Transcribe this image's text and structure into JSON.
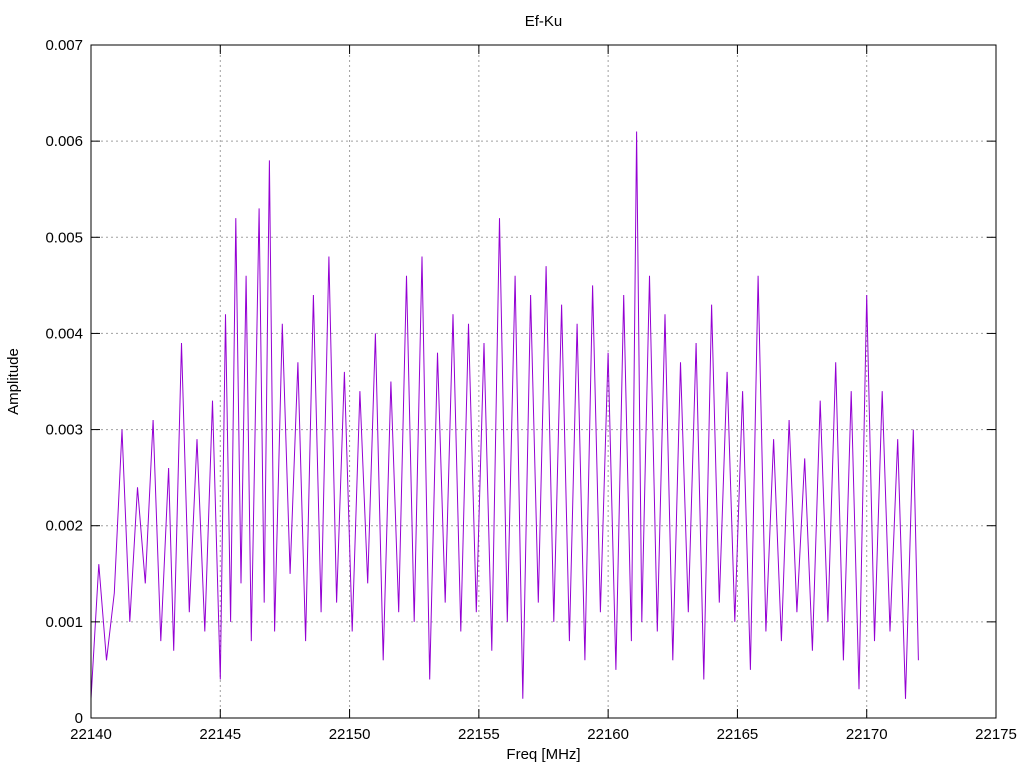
{
  "chart_data": {
    "type": "line",
    "title": "Ef-Ku",
    "xlabel": "Freq [MHz]",
    "ylabel": "Amplitude",
    "xlim": [
      22140,
      22175
    ],
    "ylim": [
      0,
      0.007
    ],
    "x_ticks": [
      22140,
      22145,
      22150,
      22155,
      22160,
      22165,
      22170,
      22175
    ],
    "y_ticks": [
      0,
      0.001,
      0.002,
      0.003,
      0.004,
      0.005,
      0.006,
      0.007
    ],
    "x_tick_labels": [
      "22140",
      "22145",
      "22150",
      "22155",
      "22160",
      "22165",
      "22170",
      "22175"
    ],
    "y_tick_labels": [
      "0",
      "0.001",
      "0.002",
      "0.003",
      "0.004",
      "0.005",
      "0.006",
      "0.007"
    ],
    "grid": true,
    "line_color": "#9400d3",
    "series": [
      {
        "x": [
          22140.0,
          22140.3,
          22140.6,
          22140.9,
          22141.2,
          22141.5,
          22141.8,
          22142.1,
          22142.4,
          22142.7,
          22143.0,
          22143.2,
          22143.5,
          22143.8,
          22144.1,
          22144.4,
          22144.7,
          22145.0,
          22145.2,
          22145.4,
          22145.6,
          22145.8,
          22146.0,
          22146.2,
          22146.5,
          22146.7,
          22146.9,
          22147.1,
          22147.4,
          22147.7,
          22148.0,
          22148.3,
          22148.6,
          22148.9,
          22149.2,
          22149.5,
          22149.8,
          22150.1,
          22150.4,
          22150.7,
          22151.0,
          22151.3,
          22151.6,
          22151.9,
          22152.2,
          22152.5,
          22152.8,
          22153.1,
          22153.4,
          22153.7,
          22154.0,
          22154.3,
          22154.6,
          22154.9,
          22155.2,
          22155.5,
          22155.8,
          22156.1,
          22156.4,
          22156.7,
          22157.0,
          22157.3,
          22157.6,
          22157.9,
          22158.2,
          22158.5,
          22158.8,
          22159.1,
          22159.4,
          22159.7,
          22160.0,
          22160.3,
          22160.6,
          22160.9,
          22161.1,
          22161.3,
          22161.6,
          22161.9,
          22162.2,
          22162.5,
          22162.8,
          22163.1,
          22163.4,
          22163.7,
          22164.0,
          22164.3,
          22164.6,
          22164.9,
          22165.2,
          22165.5,
          22165.8,
          22166.1,
          22166.4,
          22166.7,
          22167.0,
          22167.3,
          22167.6,
          22167.9,
          22168.2,
          22168.5,
          22168.8,
          22169.1,
          22169.4,
          22169.7,
          22170.0,
          22170.3,
          22170.6,
          22170.9,
          22171.2,
          22171.5,
          22171.8,
          22172.0
        ],
        "y": [
          0.0002,
          0.0016,
          0.0006,
          0.0013,
          0.003,
          0.001,
          0.0024,
          0.0014,
          0.0031,
          0.0008,
          0.0026,
          0.0007,
          0.0039,
          0.0011,
          0.0029,
          0.0009,
          0.0033,
          0.0004,
          0.0042,
          0.001,
          0.0052,
          0.0014,
          0.0046,
          0.0008,
          0.0053,
          0.0012,
          0.0058,
          0.0009,
          0.0041,
          0.0015,
          0.0037,
          0.0008,
          0.0044,
          0.0011,
          0.0048,
          0.0012,
          0.0036,
          0.0009,
          0.0034,
          0.0014,
          0.004,
          0.0006,
          0.0035,
          0.0011,
          0.0046,
          0.001,
          0.0048,
          0.0004,
          0.0038,
          0.0012,
          0.0042,
          0.0009,
          0.0041,
          0.0011,
          0.0039,
          0.0007,
          0.0052,
          0.001,
          0.0046,
          0.0002,
          0.0044,
          0.0012,
          0.0047,
          0.001,
          0.0043,
          0.0008,
          0.0041,
          0.0006,
          0.0045,
          0.0011,
          0.0038,
          0.0005,
          0.0044,
          0.0008,
          0.0061,
          0.001,
          0.0046,
          0.0009,
          0.0042,
          0.0006,
          0.0037,
          0.0011,
          0.0039,
          0.0004,
          0.0043,
          0.0012,
          0.0036,
          0.001,
          0.0034,
          0.0005,
          0.0046,
          0.0009,
          0.0029,
          0.0008,
          0.0031,
          0.0011,
          0.0027,
          0.0007,
          0.0033,
          0.001,
          0.0037,
          0.0006,
          0.0034,
          0.0003,
          0.0044,
          0.0008,
          0.0034,
          0.0009,
          0.0029,
          0.0002,
          0.003,
          0.0006
        ]
      }
    ]
  }
}
